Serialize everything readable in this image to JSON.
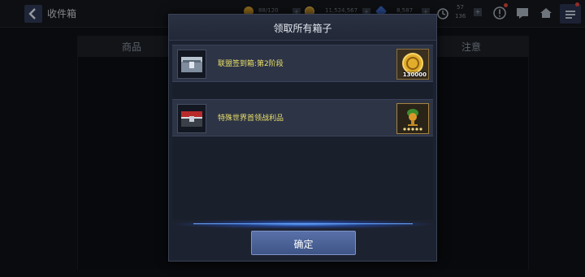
{
  "topbar": {
    "title": "收件箱",
    "resources": [
      {
        "icon": "energy-icon",
        "value": "88/120"
      },
      {
        "icon": "gold-coin-icon",
        "value": "11,524,567"
      },
      {
        "icon": "crystal-icon",
        "value": "8,587"
      }
    ],
    "timer_top": "57",
    "timer_bottom": "136",
    "icons": [
      "alert-icon",
      "chat-icon",
      "home-icon",
      "menu-icon"
    ]
  },
  "background": {
    "columns": [
      "商品",
      "注意"
    ]
  },
  "modal": {
    "title": "领取所有箱子",
    "items": [
      {
        "icon": "silver-chest-icon",
        "label": "联盟签到箱:第2阶段",
        "reward_icon": "gold-coin-icon",
        "reward_count": "130000"
      },
      {
        "icon": "red-chest-icon",
        "label": "特殊世界首领战利品",
        "reward_icon": "boss-trophy-icon",
        "reward_stars": 5
      }
    ],
    "confirm_label": "确定"
  },
  "colors": {
    "item_label": "#e9e06a",
    "confirm_button": "#4a5f94",
    "glow": "#5a9bff"
  }
}
